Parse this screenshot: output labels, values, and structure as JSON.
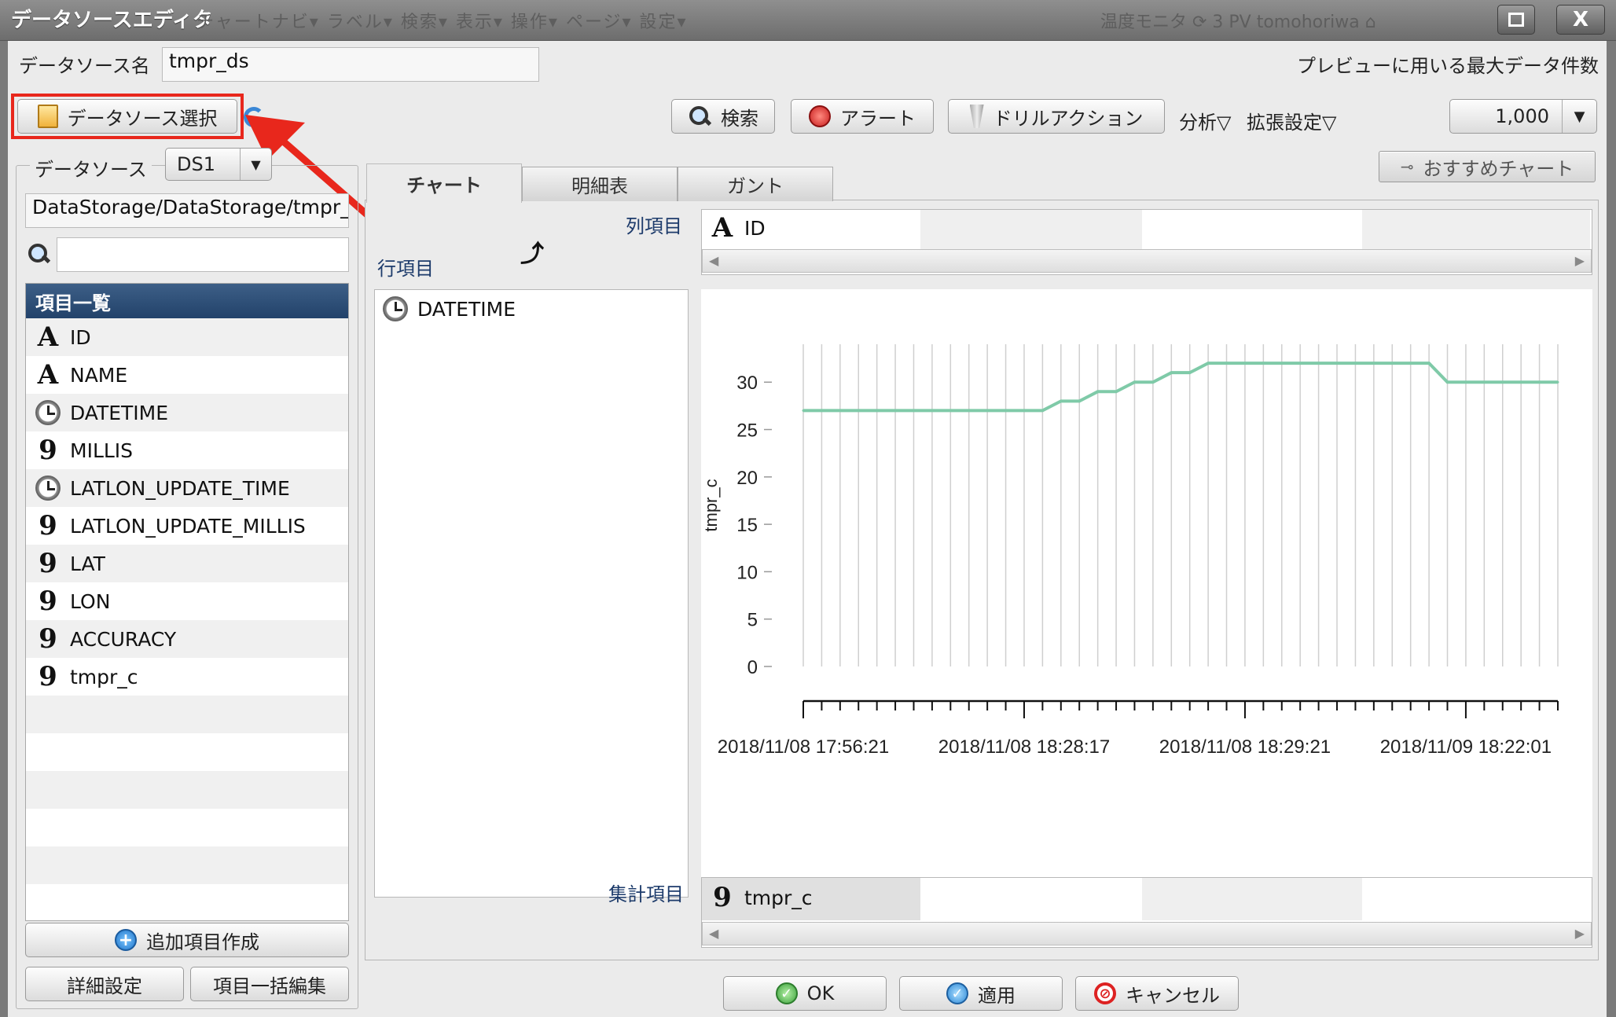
{
  "window": {
    "title": "データソースエディタ",
    "ghost_menu": "チャートナビ▾ ラベル▾ 検索▾ 表示▾ 操作▾ ページ▾ 設定▾",
    "ghost_right": "温度モニタ ⟳   3 PV   tomohoriwa ⌂",
    "close_label": "X"
  },
  "datasource_name": {
    "label": "データソース名",
    "value": "tmpr_ds"
  },
  "preview": {
    "label": "プレビューに用いる最大データ件数",
    "value": "1,000"
  },
  "toolbar": {
    "select_ds": "データソース選択",
    "search": "検索",
    "alert": "アラート",
    "drill": "ドリルアクション",
    "analysis": "分析▽",
    "ext_settings": "拡張設定▽"
  },
  "left": {
    "ds_label": "データソース",
    "ds_value": "DS1",
    "path": "DataStorage/DataStorage/tmpr_ds",
    "search_placeholder": "",
    "list_header": "項目一覧",
    "items": [
      {
        "type": "A",
        "name": "ID"
      },
      {
        "type": "A",
        "name": "NAME"
      },
      {
        "type": "clock",
        "name": "DATETIME"
      },
      {
        "type": "9",
        "name": "MILLIS"
      },
      {
        "type": "clock",
        "name": "LATLON_UPDATE_TIME"
      },
      {
        "type": "9",
        "name": "LATLON_UPDATE_MILLIS"
      },
      {
        "type": "9",
        "name": "LAT"
      },
      {
        "type": "9",
        "name": "LON"
      },
      {
        "type": "9",
        "name": "ACCURACY"
      },
      {
        "type": "9",
        "name": "tmpr_c"
      }
    ],
    "add_item": "追加項目作成",
    "detail_settings": "詳細設定",
    "bulk_edit": "項目一括編集"
  },
  "tabs": [
    "チャート",
    "明細表",
    "ガント"
  ],
  "recommend": "おすすめチャート",
  "fields": {
    "column_label": "列項目",
    "column_value": "ID",
    "row_label": "行項目",
    "row_value": "DATETIME",
    "aggregate_label": "集計項目",
    "aggregate_value": "tmpr_c"
  },
  "chart_data": {
    "type": "line",
    "ylabel": "tmpr_c",
    "yticks": [
      "30",
      "25",
      "20",
      "15",
      "10",
      "5",
      "0"
    ],
    "ylim": [
      0,
      34
    ],
    "x_tick_labels": [
      "2018/11/08 17:56:21",
      "2018/11/08 18:28:17",
      "2018/11/08 18:29:21",
      "2018/11/09 18:22:01"
    ],
    "x_count": 42,
    "series": [
      {
        "color": "#7fcaa8",
        "values": [
          27,
          27,
          27,
          27,
          27,
          27,
          27,
          27,
          27,
          27,
          27,
          27,
          27,
          27,
          28,
          28,
          29,
          29,
          30,
          30,
          31,
          31,
          32,
          32,
          32,
          32,
          32,
          32,
          32,
          32,
          32,
          32,
          32,
          32,
          32,
          30,
          30,
          30,
          30,
          30,
          30,
          30
        ]
      }
    ],
    "grid": true
  },
  "footer": {
    "ok": "OK",
    "apply": "適用",
    "cancel": "キャンセル"
  }
}
